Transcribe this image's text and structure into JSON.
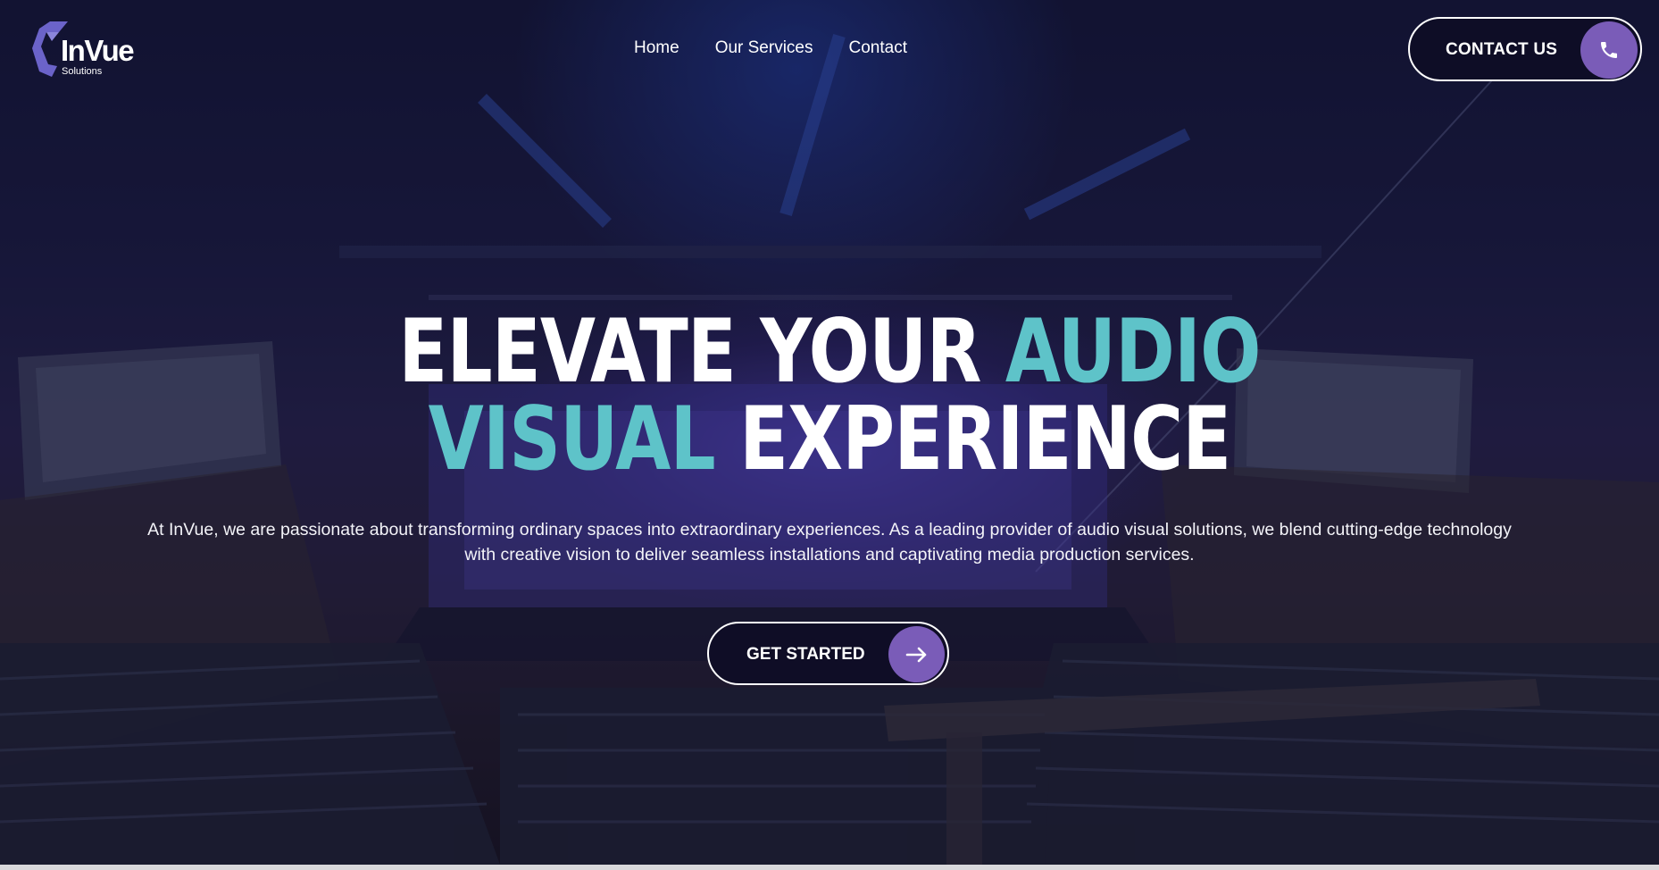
{
  "brand": {
    "name": "InVue",
    "tagline": "Solutions",
    "logo_color": "#6b63c9"
  },
  "nav": {
    "items": [
      {
        "label": "Home"
      },
      {
        "label": "Our Services"
      },
      {
        "label": "Contact"
      }
    ]
  },
  "header_cta": {
    "label": "CONTACT US",
    "icon": "phone-icon"
  },
  "hero": {
    "headline_line1": {
      "white": "ELEVATE YOUR ",
      "accent": "AUDIO"
    },
    "headline_line2": {
      "accent": "VISUAL",
      "white": " EXPERIENCE"
    },
    "description": "At InVue, we are passionate about transforming ordinary spaces into extraordinary experiences. As a leading provider of audio visual solutions, we blend cutting-edge technology with creative vision to deliver seamless installations and captivating media production services.",
    "cta_label": "GET STARTED",
    "cta_icon": "arrow-right-icon"
  },
  "colors": {
    "accent_teal": "#5ec3c9",
    "button_purple": "#7a5cb8",
    "overlay_navy": "#0e0d26"
  }
}
